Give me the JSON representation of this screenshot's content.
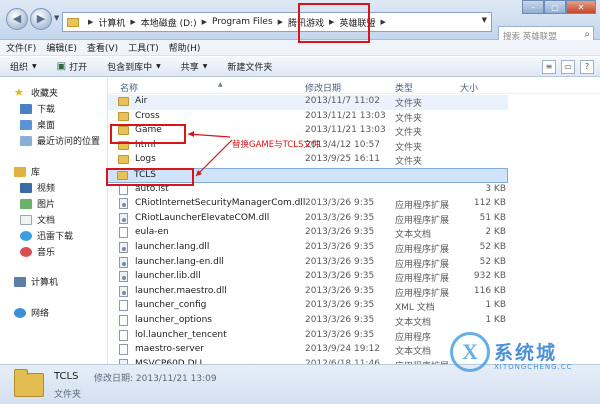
{
  "address": {
    "crumbs": [
      "计算机",
      "本地磁盘 (D:)",
      "Program Files",
      "腾讯游戏",
      "英雄联盟"
    ],
    "search_placeholder": "搜索 英雄联盟"
  },
  "menu": [
    "文件(F)",
    "编辑(E)",
    "查看(V)",
    "工具(T)",
    "帮助(H)"
  ],
  "toolbar": {
    "organize": "组织",
    "open": "打开",
    "include": "包含到库中",
    "share": "共享",
    "newfolder": "新建文件夹"
  },
  "nav": {
    "favorites": "收藏夹",
    "downloads": "下载",
    "desktop": "桌面",
    "recent": "最近访问的位置",
    "libraries": "库",
    "videos": "视频",
    "pictures": "图片",
    "documents": "文档",
    "xunlei": "迅雷下载",
    "music": "音乐",
    "computer": "计算机",
    "network": "网络"
  },
  "columns": {
    "name": "名称",
    "date": "修改日期",
    "type": "类型",
    "size": "大小"
  },
  "files": [
    {
      "name": "Air",
      "date": "2013/11/7 11:02",
      "type": "文件夹",
      "size": "",
      "kind": "folder"
    },
    {
      "name": "Cross",
      "date": "2013/11/21 13:03",
      "type": "文件夹",
      "size": "",
      "kind": "folder"
    },
    {
      "name": "Game",
      "date": "2013/11/21 13:03",
      "type": "文件夹",
      "size": "",
      "kind": "folder"
    },
    {
      "name": "html",
      "date": "2013/4/12 10:57",
      "type": "文件夹",
      "size": "",
      "kind": "folder"
    },
    {
      "name": "Logs",
      "date": "2013/9/25 16:11",
      "type": "文件夹",
      "size": "",
      "kind": "folder"
    },
    {
      "name": "TCLS",
      "date": "",
      "type": "",
      "size": "",
      "kind": "folder"
    },
    {
      "name": "auto.lst",
      "date": "",
      "type": "",
      "size": "3 KB",
      "kind": "file"
    },
    {
      "name": "CRiotInternetSecurityManagerCom.dll",
      "date": "2013/3/26 9:35",
      "type": "应用程序扩展",
      "size": "112 KB",
      "kind": "dll"
    },
    {
      "name": "CRiotLauncherElevateCOM.dll",
      "date": "2013/3/26 9:35",
      "type": "应用程序扩展",
      "size": "51 KB",
      "kind": "dll"
    },
    {
      "name": "eula-en",
      "date": "2013/3/26 9:35",
      "type": "文本文档",
      "size": "2 KB",
      "kind": "file"
    },
    {
      "name": "launcher.lang.dll",
      "date": "2013/3/26 9:35",
      "type": "应用程序扩展",
      "size": "52 KB",
      "kind": "dll"
    },
    {
      "name": "launcher.lang-en.dll",
      "date": "2013/3/26 9:35",
      "type": "应用程序扩展",
      "size": "52 KB",
      "kind": "dll"
    },
    {
      "name": "launcher.lib.dll",
      "date": "2013/3/26 9:35",
      "type": "应用程序扩展",
      "size": "932 KB",
      "kind": "dll"
    },
    {
      "name": "launcher.maestro.dll",
      "date": "2013/3/26 9:35",
      "type": "应用程序扩展",
      "size": "116 KB",
      "kind": "dll"
    },
    {
      "name": "launcher_config",
      "date": "2013/3/26 9:35",
      "type": "XML 文档",
      "size": "1 KB",
      "kind": "file"
    },
    {
      "name": "launcher_options",
      "date": "2013/3/26 9:35",
      "type": "文本文档",
      "size": "1 KB",
      "kind": "file"
    },
    {
      "name": "lol.launcher_tencent",
      "date": "2013/3/26 9:35",
      "type": "应用程序",
      "size": "",
      "kind": "file"
    },
    {
      "name": "maestro-server",
      "date": "2013/9/24 19:12",
      "type": "文本文档",
      "size": "",
      "kind": "file"
    },
    {
      "name": "MSVCP60D.DLL",
      "date": "2012/6/18 11:46",
      "type": "应用程序扩展",
      "size": "",
      "kind": "dll"
    }
  ],
  "annotation": "替换GAME与TCLS文件",
  "status": {
    "name": "TCLS",
    "date_label": "修改日期: 2013/11/21 13:09",
    "type": "文件夹"
  },
  "watermark": {
    "brand": "系统城",
    "domain": "XITONGCHENG.CC"
  }
}
